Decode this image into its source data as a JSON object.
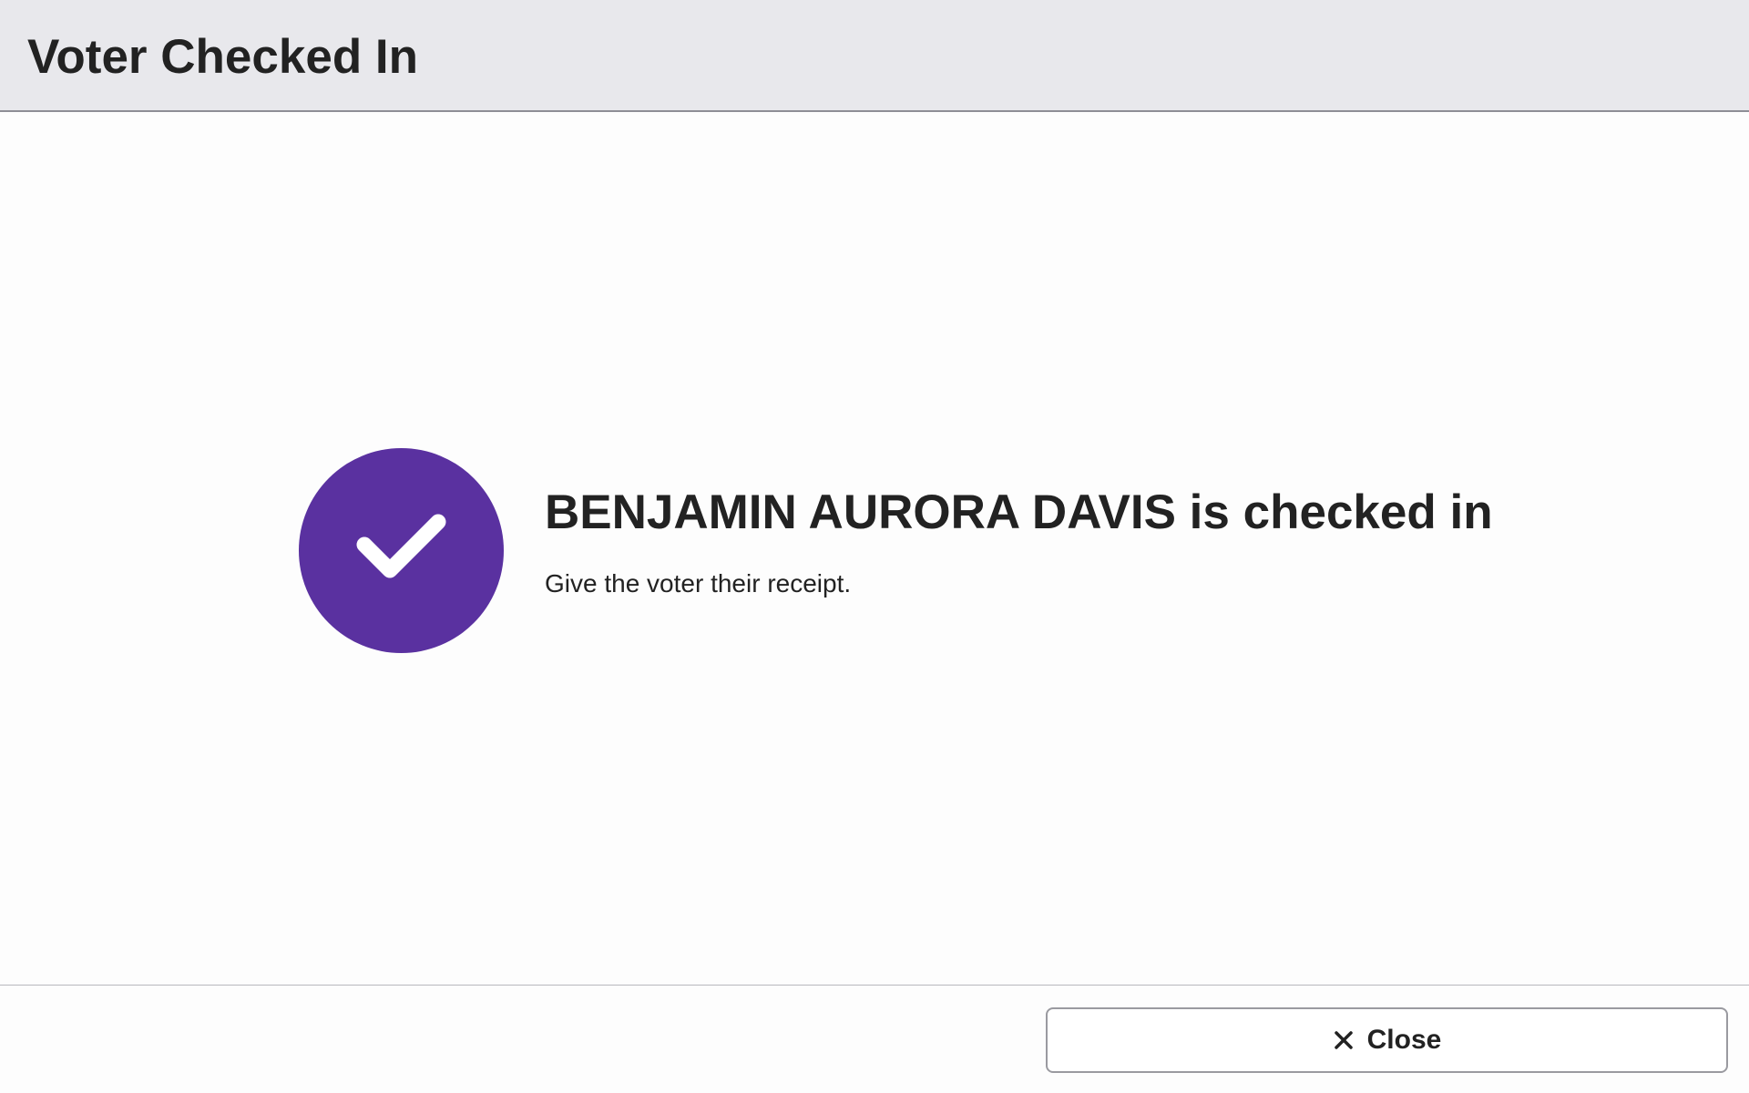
{
  "header": {
    "title": "Voter Checked In"
  },
  "status": {
    "icon": "checkmark-circle-icon",
    "title": "BENJAMIN AURORA DAVIS is checked in",
    "message": "Give the voter their receipt."
  },
  "footer": {
    "close_label": "Close",
    "close_icon": "close-icon"
  },
  "colors": {
    "accent": "#5a31a0",
    "header_background": "#e8e8ec",
    "text": "#222222"
  }
}
